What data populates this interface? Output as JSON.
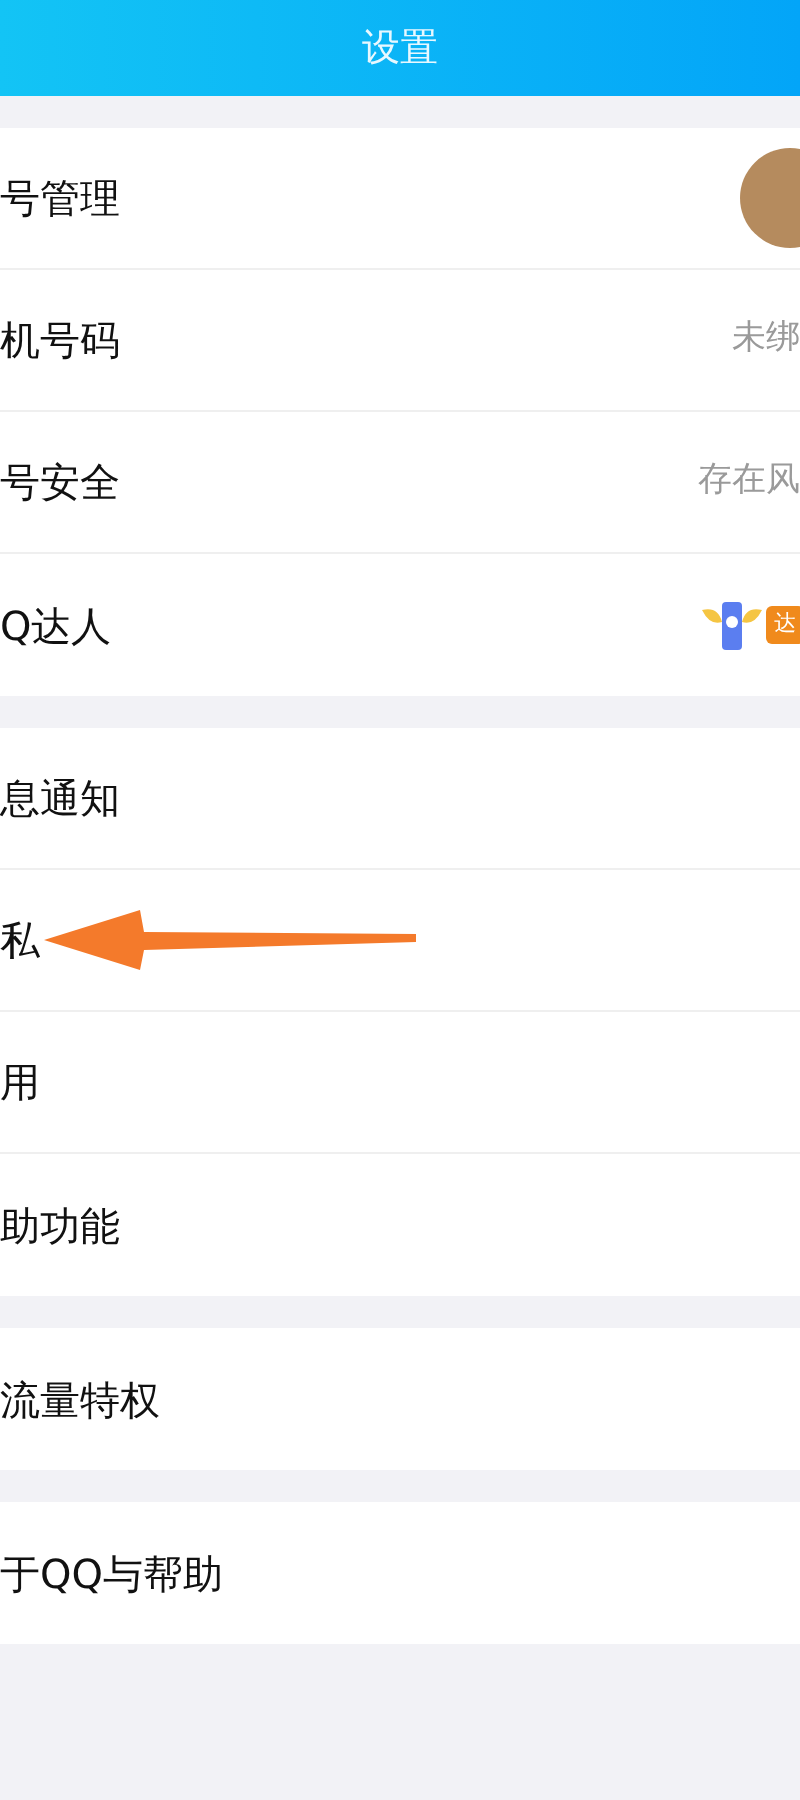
{
  "header": {
    "title": "设置"
  },
  "groups": [
    {
      "rows": [
        {
          "kind": "avatar",
          "label": "号管理"
        },
        {
          "kind": "value",
          "label": "机号码",
          "value": "未绑"
        },
        {
          "kind": "value",
          "label": "号安全",
          "value": "存在风"
        },
        {
          "kind": "badge",
          "label": "Q达人",
          "badge": "达"
        }
      ]
    },
    {
      "rows": [
        {
          "kind": "plain",
          "label": "息通知"
        },
        {
          "kind": "arrow",
          "label": "私"
        },
        {
          "kind": "plain",
          "label": "用"
        },
        {
          "kind": "plain",
          "label": "助功能"
        }
      ]
    },
    {
      "rows": [
        {
          "kind": "plain",
          "label": "流量特权"
        }
      ]
    },
    {
      "rows": [
        {
          "kind": "plain",
          "label": "于QQ与帮助"
        }
      ]
    }
  ]
}
